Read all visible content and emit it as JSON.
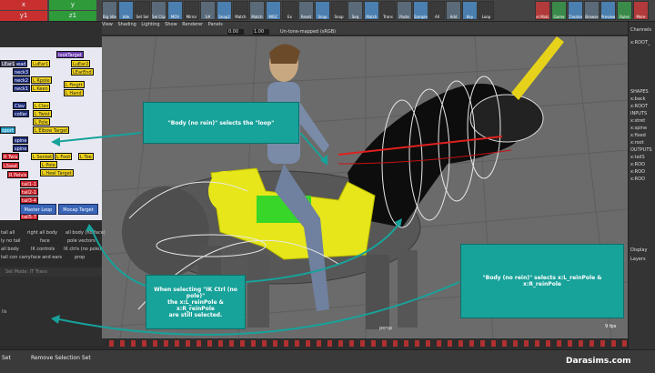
{
  "shelf": {
    "xyz": {
      "x": "x",
      "y": "y",
      "z": "z",
      "x1": "x1",
      "y1": "y1",
      "z1": "z1"
    },
    "buttons": [
      "Big Idle",
      "Idle",
      "Set Sel",
      "Sel Clip",
      "MOV",
      "Mirror",
      "S#",
      "Snap2",
      "Match",
      "Match",
      "MISC",
      "Ex",
      "Reset",
      "Snap",
      "Snap",
      "Seq",
      "Match",
      "Trans",
      "Paste",
      "Sample",
      "All",
      "Add",
      "Key",
      "Loop"
    ],
    "right_buttons": [
      "Sel Match",
      "Game",
      "Cheater",
      "Browse",
      "Preview",
      "Rules",
      "More"
    ]
  },
  "viewport": {
    "menu": [
      "View",
      "Shading",
      "Lighting",
      "Show",
      "Renderer",
      "Panels"
    ],
    "field_a": "0.00",
    "field_b": "1.00",
    "colorspace": "Un-tone-mapped (sRGB)",
    "camera": "persp",
    "fps": "9 fps"
  },
  "picker": {
    "tab": "lookTarget",
    "labels": {
      "head": "head",
      "neck3": "neck3",
      "neck2": "neck2",
      "neck1": "neck1",
      "lear1": "LEar1",
      "rear1": "LuEar1",
      "rear2": "LuEar2",
      "lueare": "LEarEnd",
      "lpole": "L Pole",
      "rpole": "L Rpole",
      "rkeen": "L Keen",
      "lfinger": "L Fingtt",
      "lhand": "L Hand",
      "lclav": "L Clav",
      "ltwist": "L Twist",
      "lpole2": "L Pole",
      "lelbow": "L Elbow Target",
      "lsocket": "L Socket",
      "lfoot": "L Foot",
      "ltoe": "L Toe",
      "lpole3": "L Pole",
      "lheel": "L Heel Target",
      "clav": "Clav",
      "collar": "collar",
      "spine": "spine",
      "spine2": "spine",
      "rpelvis": "R Pelvis",
      "tail1": "tail1-1",
      "tail2": "tail2-1",
      "tail3": "tail3-4",
      "tail4": "tail4-5",
      "tail5": "tail5-7",
      "master_loop": "Master Loop",
      "mocap_target": "Mocap Target",
      "lass": "lass",
      "rtwis": "R Twis",
      "sport": "sport",
      "lswat": "LSwat"
    }
  },
  "sets": {
    "cells": [
      "tail all",
      "right all body",
      "all body (no face)",
      "ly no tail",
      "face",
      "pole vectors",
      "all body",
      "IK controls",
      "IK ctrls (no pole)",
      "tail con carry",
      "face and ears",
      "prop"
    ],
    "bar": "Set Mode: IT Trans"
  },
  "bottom": {
    "left_label": "Set",
    "remove": "Remove Selection Set",
    "mid_label": "Ils"
  },
  "channels": {
    "title": "Channels",
    "root": "x:ROOT_",
    "shapes": "SHAPES",
    "items": [
      "x:back",
      "x:ROOT",
      "INPUTS",
      "x:stret",
      "x:spine",
      "x:fixed",
      "x:root",
      "OUTPUTS",
      "x:tailS",
      "x:ROO",
      "x:ROO",
      "x:ROO"
    ],
    "display": "Display",
    "layers": "Layers"
  },
  "callouts": {
    "c1": "\"Body (no rein)\" selects the \"loop\"",
    "c2": "When selecting  \"IK Ctrl (no pole)\"\nthe  x:L_reinPole & x:R_reinPole\nare still selected.",
    "c3": "\"Body (no rein)\" selects x:L_reinPole & x:R_reinPole"
  },
  "colors": {
    "callout": "#17a29a",
    "viewport_bg": "#6b6b6b",
    "saddle": "#e6e61a"
  },
  "watermark": "Darasims.com"
}
